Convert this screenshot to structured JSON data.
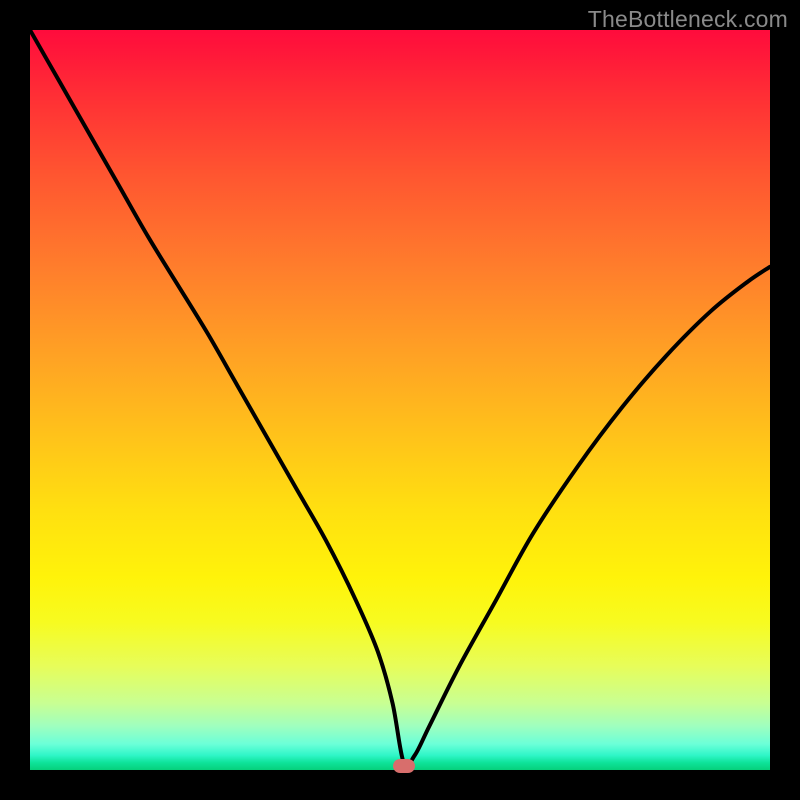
{
  "watermark": "TheBottleneck.com",
  "chart_data": {
    "type": "line",
    "title": "",
    "xlabel": "",
    "ylabel": "",
    "xlim": [
      0,
      100
    ],
    "ylim": [
      0,
      100
    ],
    "background": "vertical red-yellow-green gradient",
    "series": [
      {
        "name": "curve",
        "x": [
          0,
          4,
          8,
          12,
          16,
          20,
          24,
          28,
          32,
          36,
          40,
          44,
          47,
          49,
          50.5,
          52,
          54,
          58,
          63,
          68,
          74,
          80,
          86,
          92,
          97,
          100
        ],
        "y": [
          100,
          93,
          86,
          79,
          72,
          65.5,
          59,
          52,
          45,
          38,
          31,
          23,
          16,
          9,
          1,
          2,
          6,
          14,
          23,
          32,
          41,
          49,
          56,
          62,
          66,
          68
        ]
      }
    ],
    "marker": {
      "x": 50.5,
      "y": 0.6,
      "color": "#d86e6c"
    }
  }
}
